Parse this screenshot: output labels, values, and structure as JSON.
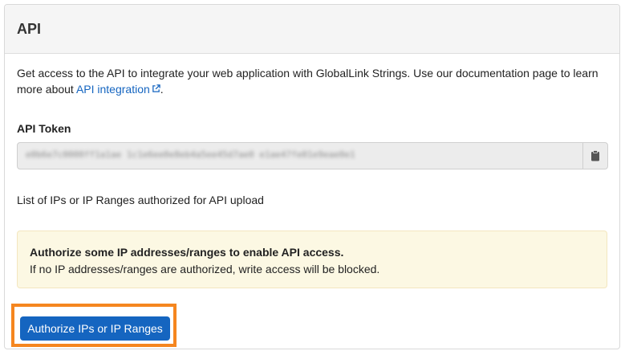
{
  "panel": {
    "title": "API",
    "intro_text": "Get access to the API to integrate your web application with GlobalLink Strings. Use our documentation page to learn more about ",
    "intro_link": "API integration",
    "intro_suffix": "."
  },
  "token": {
    "label": "API Token",
    "value": "e0b6e7c0000ff1a1ae 1c1e6ee0e8eb4a5ee45d7ae0 e1ae47fe01e9eae0e1"
  },
  "ip_section": {
    "label": "List of IPs or IP Ranges authorized for API upload"
  },
  "alert": {
    "title": "Authorize some IP addresses/ranges to enable API access.",
    "body": "If no IP addresses/ranges are authorized, write access will be blocked."
  },
  "actions": {
    "authorize_label": "Authorize IPs or IP Ranges"
  },
  "colors": {
    "accent": "#1565c0",
    "highlight": "#f5861f",
    "alert_bg": "#fcf8e3"
  },
  "icons": {
    "external_link": "external-link-icon",
    "copy": "clipboard-icon"
  }
}
